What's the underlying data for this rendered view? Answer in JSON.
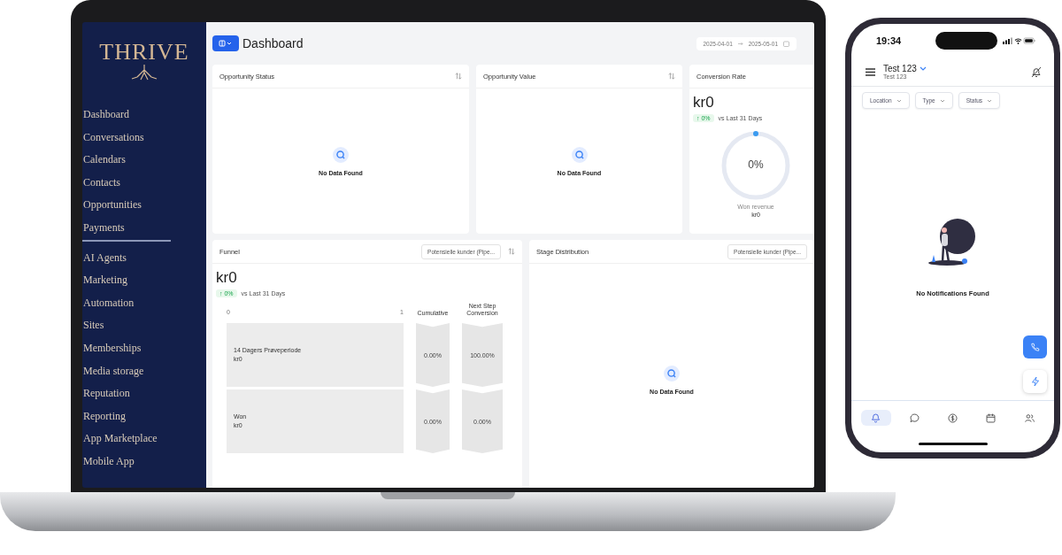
{
  "laptop": {
    "sidebar": {
      "logo": "THRIVE",
      "groups": [
        {
          "items": [
            "Dashboard",
            "Conversations",
            "Calendars",
            "Contacts",
            "Opportunities",
            "Payments"
          ]
        },
        {
          "items": [
            "AI Agents",
            "Marketing",
            "Automation",
            "Sites",
            "Memberships",
            "Media storage",
            "Reputation",
            "Reporting",
            "App Marketplace",
            "Mobile App"
          ]
        }
      ]
    },
    "header": {
      "title": "Dashboard",
      "date_start": "2025-04-01",
      "date_end": "2025-05-01"
    },
    "cards": [
      {
        "kind": "empty",
        "title": "Opportunity Status",
        "message": "No Data Found"
      },
      {
        "kind": "empty",
        "title": "Opportunity Value",
        "message": "No Data Found"
      },
      {
        "kind": "ring",
        "title": "Conversion Rate",
        "value": "kr0",
        "change": "↑ 0%",
        "compare": "vs Last 31 Days",
        "ring_label": "0%",
        "caption": "Won revenue",
        "caption_value": "kr0"
      }
    ],
    "funnel": {
      "title": "Funnel",
      "pipeline": "Potensielle kunder (Pipe...",
      "value": "kr0",
      "change": "↑ 0%",
      "compare": "vs Last 31 Days",
      "axis": [
        "0",
        "1"
      ],
      "columns": [
        "Cumulative",
        "Next Step Conversion"
      ],
      "stages": [
        {
          "name": "14 Dagers Prøveperiode",
          "value": "kr0",
          "cumulative": "0.00%",
          "next_step": "100.00%"
        },
        {
          "name": "Won",
          "value": "kr0",
          "cumulative": "0.00%",
          "next_step": "0.00%"
        }
      ]
    },
    "stage_distribution": {
      "title": "Stage Distribution",
      "pipeline": "Potensielle kunder (Pipe...",
      "message": "No Data Found"
    }
  },
  "phone": {
    "time": "19:34",
    "account": "Test 123",
    "subaccount": "Test 123",
    "filters": [
      "Location",
      "Type",
      "Status"
    ],
    "message": "No Notifications Found",
    "nav": [
      {
        "kind": "bell",
        "selected": true
      },
      {
        "kind": "chat",
        "selected": false
      },
      {
        "kind": "dollar",
        "selected": false
      },
      {
        "kind": "calendar",
        "selected": false
      },
      {
        "kind": "people",
        "selected": false
      }
    ]
  }
}
